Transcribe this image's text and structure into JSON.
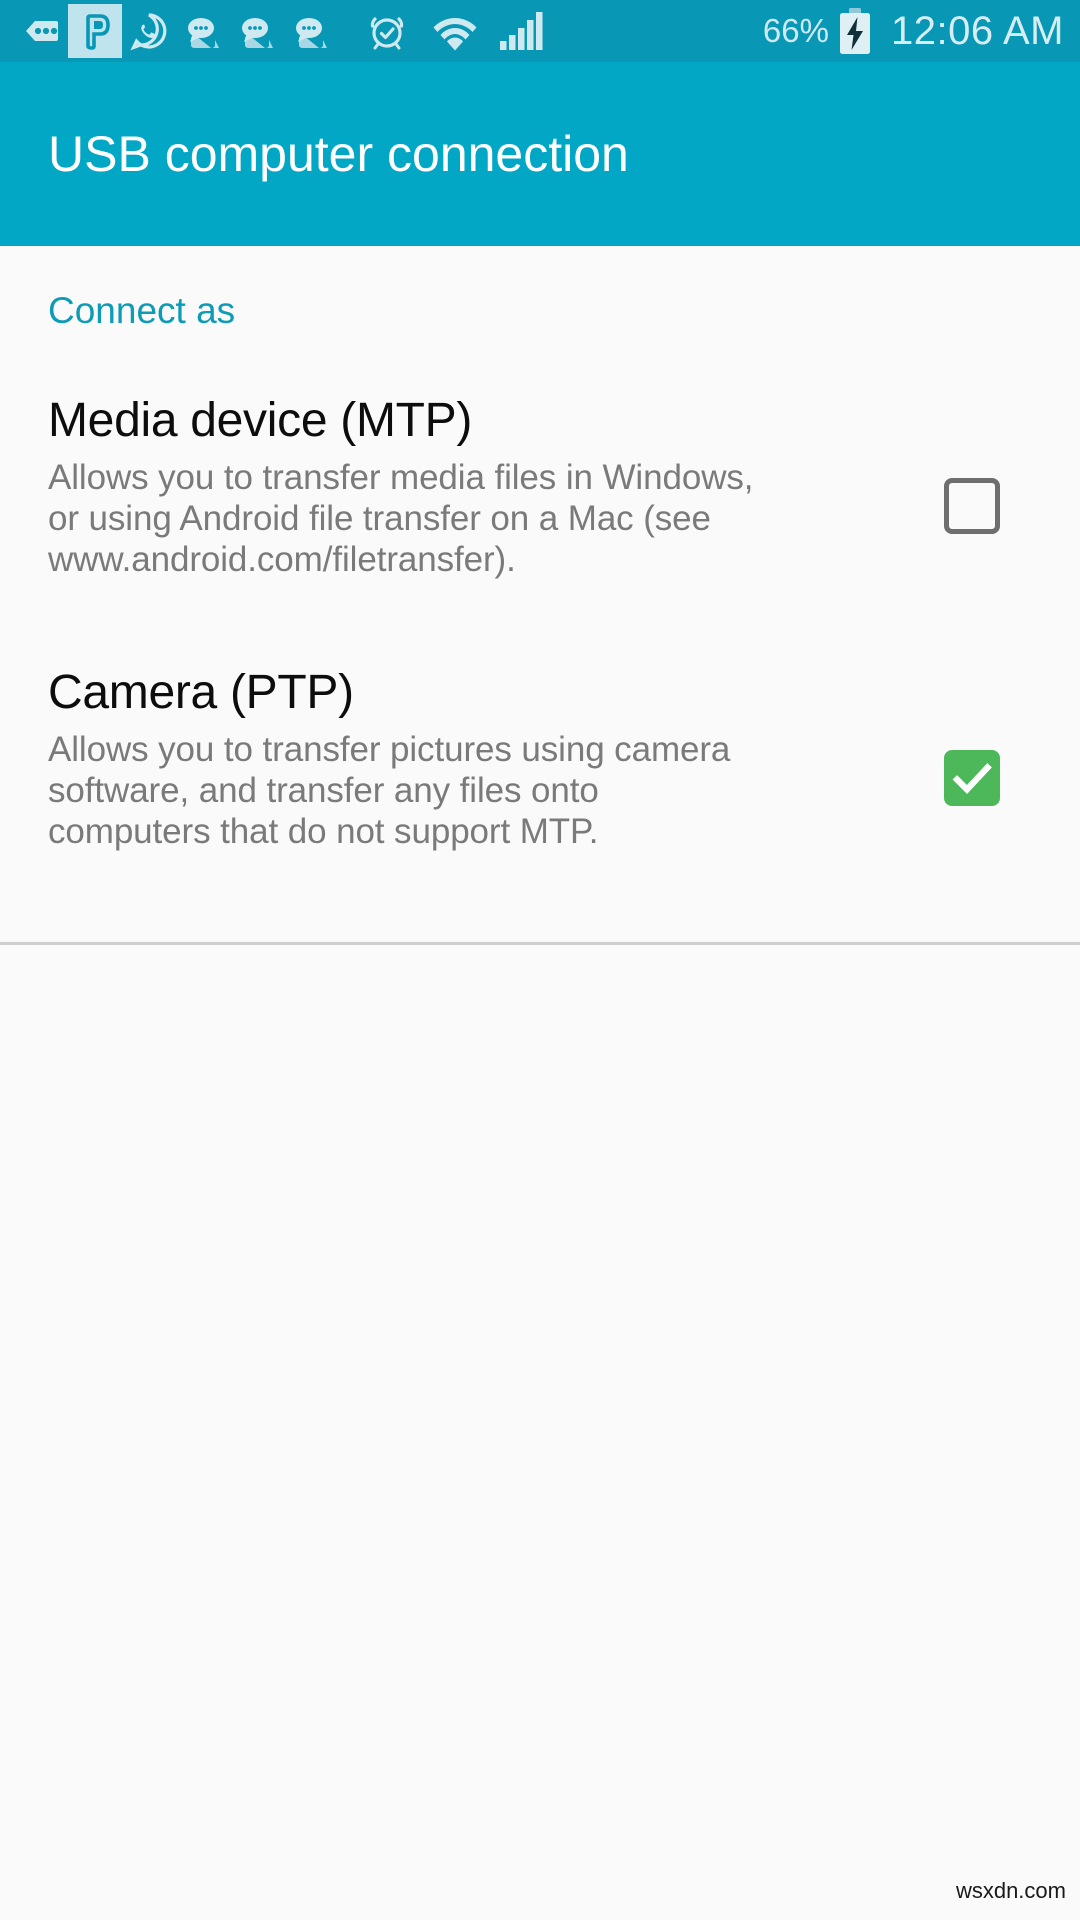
{
  "status_bar": {
    "background_color": "#0897b5",
    "icon_color": "#cfe9f0",
    "icons": [
      {
        "name": "more-notifications-icon",
        "label": "more notifications"
      },
      {
        "name": "pushbullet-app-icon",
        "label": "P app notification",
        "highlighted": true
      },
      {
        "name": "whatsapp-icon",
        "label": "WhatsApp"
      },
      {
        "name": "message-bubbles-icon",
        "label": "new message"
      },
      {
        "name": "message-bubbles-icon",
        "label": "new message"
      },
      {
        "name": "message-bubbles-icon",
        "label": "new message"
      },
      {
        "name": "alarm-clock-icon",
        "label": "alarm set"
      },
      {
        "name": "wifi-icon",
        "label": "Wi-Fi connected"
      },
      {
        "name": "signal-bars-icon",
        "label": "mobile signal"
      }
    ],
    "battery_percent": "66%",
    "battery_state": "charging",
    "clock": "12:06 AM"
  },
  "action_bar": {
    "title": "USB computer connection",
    "background_color": "#02a7c5",
    "title_color": "#ffffff"
  },
  "content": {
    "background_color": "#fafafa",
    "section_header": {
      "label": "Connect as",
      "color": "#0e9bb5"
    },
    "options": [
      {
        "title": "Media device (MTP)",
        "summary_lines": [
          "Allows you to transfer media files in Windows,",
          "or using Android file transfer on a Mac (see",
          "www.android.com/filetransfer)."
        ],
        "checked": false,
        "checkbox_name": "checkbox-media-device-mtp"
      },
      {
        "title": "Camera (PTP)",
        "summary_lines": [
          "Allows you to transfer pictures using camera",
          "software, and transfer any files onto",
          "computers that do not support MTP."
        ],
        "checked": true,
        "checkbox_name": "checkbox-camera-ptp",
        "checked_color": "#4cb85a"
      }
    ]
  },
  "watermark": {
    "text": "wsxdn.com"
  }
}
